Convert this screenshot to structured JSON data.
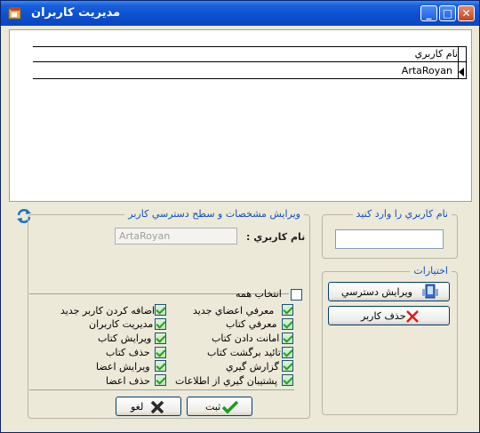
{
  "window": {
    "title": "مديريت كاربران"
  },
  "grid": {
    "column_header": "نام كاربري",
    "rows": [
      "ArtaRoyan"
    ]
  },
  "edit_panel": {
    "legend": "ويرايش مشخصات و سطح دسترسي كاربر",
    "username_label": "نام كاربري :",
    "username_value": "ArtaRoyan",
    "select_all_label": "انتخاب همه",
    "permissions_right": [
      {
        "label": "معرفي اعضاي جديد",
        "checked": true
      },
      {
        "label": "معرفي كتاب",
        "checked": true
      },
      {
        "label": "امانت دادن كتاب",
        "checked": true
      },
      {
        "label": "تائيد برگشت كتاب",
        "checked": true
      },
      {
        "label": "گزارش گيري",
        "checked": true
      },
      {
        "label": "پشتيبان گيري از اطلاعات",
        "checked": true
      }
    ],
    "permissions_left": [
      {
        "label": "اضافه كردن كاربر جديد",
        "checked": true
      },
      {
        "label": "مديريت كاربران",
        "checked": true
      },
      {
        "label": "ويرايش كتاب",
        "checked": true
      },
      {
        "label": "حذف كتاب",
        "checked": true
      },
      {
        "label": "ويرايش اعضا",
        "checked": true
      },
      {
        "label": "حذف اعضا",
        "checked": true
      }
    ],
    "save_label": "ثبت",
    "cancel_label": "لغو"
  },
  "username_panel": {
    "legend": "نام كاربري را وارد كنيد",
    "value": ""
  },
  "options_panel": {
    "legend": "اختيارات",
    "edit_access_label": "ويرايش دسترسي",
    "delete_user_label": "حذف كاربر"
  },
  "colors": {
    "accent": "#1050C8",
    "check": "#21A121",
    "delete": "#E01818"
  }
}
